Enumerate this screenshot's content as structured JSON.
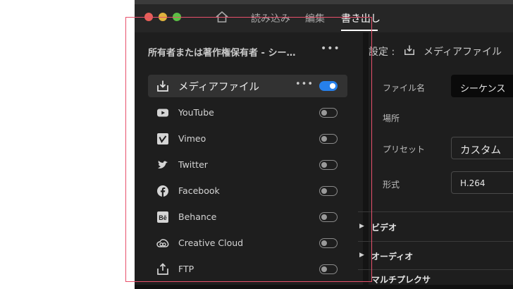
{
  "nav": {
    "tabs": [
      {
        "label": "読み込み",
        "active": false
      },
      {
        "label": "編集",
        "active": false
      },
      {
        "label": "書き出し",
        "active": true
      }
    ]
  },
  "destinations": {
    "title": "所有者または著作権保有者 - シーケン…",
    "items": [
      {
        "label": "メディアファイル",
        "icon": "media-file-download-icon",
        "enabled": true,
        "selected": true
      },
      {
        "label": "YouTube",
        "icon": "youtube-icon",
        "enabled": false
      },
      {
        "label": "Vimeo",
        "icon": "vimeo-icon",
        "enabled": false
      },
      {
        "label": "Twitter",
        "icon": "twitter-icon",
        "enabled": false
      },
      {
        "label": "Facebook",
        "icon": "facebook-icon",
        "enabled": false
      },
      {
        "label": "Behance",
        "icon": "behance-icon",
        "enabled": false
      },
      {
        "label": "Creative Cloud",
        "icon": "creative-cloud-icon",
        "enabled": false
      },
      {
        "label": "FTP",
        "icon": "ftp-upload-icon",
        "enabled": false
      }
    ]
  },
  "settings": {
    "header": "設定 :",
    "destination": "メディアファイル",
    "fields": {
      "filename": {
        "label": "ファイル名",
        "value": "シーケンス"
      },
      "location": {
        "label": "場所"
      },
      "preset": {
        "label": "プリセット",
        "value": "カスタム"
      },
      "format": {
        "label": "形式",
        "value": "H.264"
      }
    },
    "sections": [
      "ビデオ",
      "オーディオ",
      "マルチプレクサ"
    ]
  },
  "colors": {
    "accent": "#2680eb",
    "annotation_frame": "#e8506b",
    "traffic_red": "#e65f58",
    "traffic_yellow": "#e0b43d",
    "traffic_green": "#5bbf45"
  }
}
